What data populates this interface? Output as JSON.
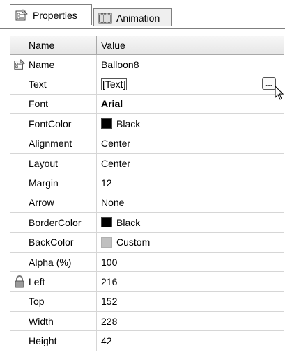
{
  "tabs": [
    {
      "label": "Properties",
      "icon": "properties-icon",
      "active": true
    },
    {
      "label": "Animation",
      "icon": "animation-icon",
      "active": false
    }
  ],
  "grid": {
    "header": {
      "name": "Name",
      "value": "Value"
    },
    "rows": [
      {
        "name": "Name",
        "value": "Balloon8",
        "icon": "properties-icon"
      },
      {
        "name": "Text",
        "value": "[Text]"
      },
      {
        "name": "Font",
        "value": "Arial"
      },
      {
        "name": "FontColor",
        "value": "Black",
        "swatch": "#000000"
      },
      {
        "name": "Alignment",
        "value": "Center"
      },
      {
        "name": "Layout",
        "value": "Center"
      },
      {
        "name": "Margin",
        "value": "12"
      },
      {
        "name": "Arrow",
        "value": "None"
      },
      {
        "name": "BorderColor",
        "value": "Black",
        "swatch": "#000000"
      },
      {
        "name": "BackColor",
        "value": "Custom",
        "swatch": "#c0c0c0"
      },
      {
        "name": "Alpha (%)",
        "value": "100"
      },
      {
        "name": "Left",
        "value": "216",
        "icon": "lock-icon"
      },
      {
        "name": "Top",
        "value": "152"
      },
      {
        "name": "Width",
        "value": "228"
      },
      {
        "name": "Height",
        "value": "42"
      }
    ]
  },
  "ellipsis_label": "..."
}
